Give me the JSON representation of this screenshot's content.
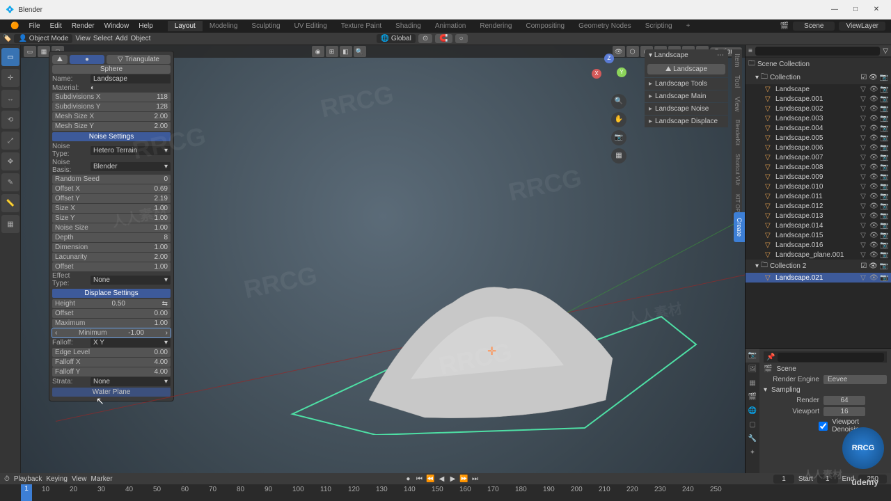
{
  "titlebar": {
    "app": "Blender"
  },
  "menu": {
    "file": "File",
    "edit": "Edit",
    "render": "Render",
    "window": "Window",
    "help": "Help"
  },
  "workspaces": [
    "Layout",
    "Modeling",
    "Sculpting",
    "UV Editing",
    "Texture Paint",
    "Shading",
    "Animation",
    "Rendering",
    "Compositing",
    "Geometry Nodes",
    "Scripting"
  ],
  "workspace_active": 0,
  "scene_label": "Scene",
  "viewlayer_label": "ViewLayer",
  "header": {
    "mode": "Object Mode",
    "view": "View",
    "select": "Select",
    "add": "Add",
    "object": "Object",
    "orientation": "Global"
  },
  "viewport_options": "Options",
  "npanel": {
    "tri": "Triangulate",
    "sphere": "Sphere",
    "name_lbl": "Name:",
    "name_val": "Landscape",
    "material_lbl": "Material:",
    "subx_lbl": "Subdivisions X",
    "subx_val": "118",
    "suby_lbl": "Subdivisions Y",
    "suby_val": "128",
    "meshx_lbl": "Mesh Size X",
    "meshx_val": "2.00",
    "meshy_lbl": "Mesh Size Y",
    "meshy_val": "2.00",
    "noise_hdr": "Noise Settings",
    "ntype_lbl": "Noise Type:",
    "ntype_val": "Hetero Terrain",
    "nbasis_lbl": "Noise Basis:",
    "nbasis_val": "Blender",
    "seed_lbl": "Random Seed",
    "seed_val": "0",
    "offx_lbl": "Offset X",
    "offx_val": "0.69",
    "offy_lbl": "Offset Y",
    "offy_val": "2.19",
    "sizex_lbl": "Size X",
    "sizex_val": "1.00",
    "sizey_lbl": "Size Y",
    "sizey_val": "1.00",
    "nsize_lbl": "Noise Size",
    "nsize_val": "1.00",
    "depth_lbl": "Depth",
    "depth_val": "8",
    "dim_lbl": "Dimension",
    "dim_val": "1.00",
    "lac_lbl": "Lacunarity",
    "lac_val": "2.00",
    "off_lbl": "Offset",
    "off_val": "1.00",
    "eff_lbl": "Effect Type:",
    "eff_val": "None",
    "disp_hdr": "Displace Settings",
    "height_lbl": "Height",
    "height_val": "0.50",
    "doff_lbl": "Offset",
    "doff_val": "0.00",
    "max_lbl": "Maximum",
    "max_val": "1.00",
    "min_lbl": "Minimum",
    "min_val": "-1.00",
    "falloff_lbl": "Falloff:",
    "falloff_val": "X Y",
    "edge_lbl": "Edge Level",
    "edge_val": "0.00",
    "fx_lbl": "Falloff X",
    "fx_val": "4.00",
    "fy_lbl": "Falloff Y",
    "fy_val": "4.00",
    "strata_lbl": "Strata:",
    "strata_val": "None",
    "water_hdr": "Water Plane"
  },
  "rpanel": {
    "title": "Landscape",
    "refresh": "Landscape",
    "tools": "Landscape Tools",
    "main": "Landscape Main",
    "noise": "Landscape Noise",
    "disp": "Landscape Displace",
    "tabs": [
      "Item",
      "Tool",
      "View",
      "Shortcut VUr",
      "BlenderKit",
      "KIT OPS"
    ],
    "create": "Create"
  },
  "outliner": {
    "scene_coll": "Scene Collection",
    "coll1": "Collection",
    "coll2": "Collection 2",
    "items": [
      "Landscape",
      "Landscape.001",
      "Landscape.002",
      "Landscape.003",
      "Landscape.004",
      "Landscape.005",
      "Landscape.006",
      "Landscape.007",
      "Landscape.008",
      "Landscape.009",
      "Landscape.010",
      "Landscape.011",
      "Landscape.012",
      "Landscape.013",
      "Landscape.014",
      "Landscape.015",
      "Landscape.016",
      "Landscape_plane.001"
    ],
    "sel": "Landscape.021"
  },
  "props": {
    "scene": "Scene",
    "engine_lbl": "Render Engine",
    "engine_val": "Eevee",
    "sampling": "Sampling",
    "render_lbl": "Render",
    "render_val": "64",
    "viewport_lbl": "Viewport",
    "viewport_val": "16",
    "denoise": "Viewport Denoising"
  },
  "timeline": {
    "playback": "Playback",
    "keying": "Keying",
    "view": "View",
    "marker": "Marker",
    "current": "1",
    "start_lbl": "Start",
    "start": "1",
    "end_lbl": "End",
    "end": "250",
    "ticks": [
      "10",
      "20",
      "30",
      "40",
      "50",
      "60",
      "70",
      "80",
      "90",
      "100",
      "110",
      "120",
      "130",
      "140",
      "150",
      "160",
      "170",
      "180",
      "190",
      "200",
      "210",
      "220",
      "230",
      "240",
      "250"
    ]
  },
  "watermarks": [
    "RRCG",
    "人人素材"
  ],
  "footer_brand": "ûdemy"
}
